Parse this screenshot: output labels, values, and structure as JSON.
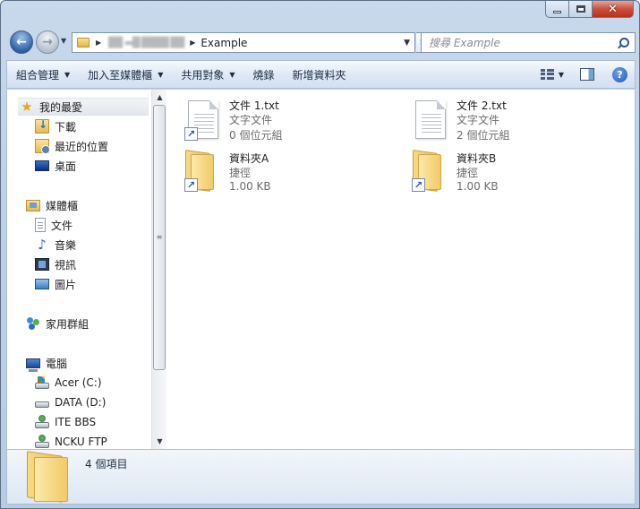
{
  "window": {
    "close_symbol": "✕"
  },
  "address_bar": {
    "path_hidden": "██ ▬█ ████ ██",
    "current_folder": "Example"
  },
  "search": {
    "placeholder": "搜尋 Example"
  },
  "toolbar": {
    "organize": "組合管理",
    "include_in_library": "加入至媒體櫃",
    "share_with": "共用對象",
    "burn": "燒錄",
    "new_folder": "新增資料夾"
  },
  "nav": {
    "favorites": "我的最愛",
    "downloads": "下載",
    "recent_places": "最近的位置",
    "desktop": "桌面",
    "libraries": "媒體櫃",
    "documents": "文件",
    "music": "音樂",
    "videos": "視訊",
    "pictures": "圖片",
    "homegroup": "家用群組",
    "computer": "電腦",
    "drive_c": "Acer (C:)",
    "drive_d": "DATA (D:)",
    "net_ite": "ITE BBS",
    "net_ncku": "NCKU FTP"
  },
  "files": [
    {
      "name": "文件 1.txt",
      "type": "文字文件",
      "size": "0 個位元組",
      "icon": "text-file-shortcut"
    },
    {
      "name": "文件 2.txt",
      "type": "文字文件",
      "size": "2 個位元組",
      "icon": "text-file"
    },
    {
      "name": "資料夾A",
      "type": "捷徑",
      "size": "1.00 KB",
      "icon": "folder-shortcut"
    },
    {
      "name": "資料夾B",
      "type": "捷徑",
      "size": "1.00 KB",
      "icon": "folder-shortcut"
    }
  ],
  "details": {
    "item_count": "4 個項目"
  }
}
